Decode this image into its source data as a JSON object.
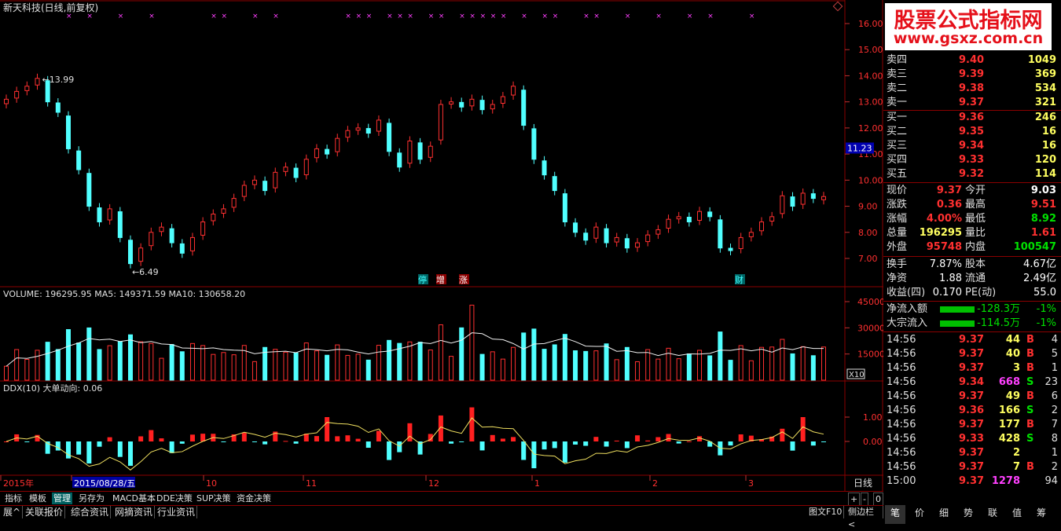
{
  "title": "新天科技(日线,前复权)",
  "price_axis": {
    "ticks": [
      "16.00",
      "15.00",
      "14.00",
      "13.00",
      "12.00",
      "11.00",
      "10.00",
      "9.00",
      "8.00",
      "7.00"
    ],
    "current_marker": "11.23"
  },
  "annotations": {
    "high": "13.99",
    "low": "6.49"
  },
  "x_marks": [
    "×",
    "×",
    "×",
    "×",
    "×",
    "×",
    "×",
    "×",
    "×",
    "×",
    "×",
    "×",
    "×",
    "×",
    "×",
    "×",
    "×",
    "×",
    "×",
    "×",
    "×",
    "×",
    "×",
    "×",
    "×",
    "×",
    "×",
    "×",
    "×",
    "×",
    "×"
  ],
  "event_tags": [
    {
      "text": "停",
      "color": "#40ffff"
    },
    {
      "text": "增",
      "color": "#ffffff"
    },
    {
      "text": "涨",
      "color": "#ffffff"
    },
    {
      "text": "财",
      "color": "#40ffff"
    }
  ],
  "volume": {
    "header": "VOLUME: 196295.95  MA5: 149371.59  MA10: 130658.20",
    "ticks": [
      "45000",
      "30000",
      "15000"
    ],
    "unit": "X10"
  },
  "ddx": {
    "header": "DDX(10)  大单动向: 0.06",
    "ticks": [
      "1.00",
      "0.00"
    ]
  },
  "date_axis": {
    "labels": [
      "2015年",
      "2015/08/28/五",
      "10",
      "11",
      "12",
      "1",
      "2",
      "3"
    ],
    "period": "日线"
  },
  "chart_data": [
    {
      "type": "candlestick",
      "title": "新天科技(日线,前复权)",
      "ylim": [
        6.4,
        16.3
      ],
      "y_ticks": [
        7,
        8,
        9,
        10,
        11,
        12,
        13,
        14,
        15,
        16
      ],
      "x_labels": [
        "2015年",
        "2015/08/28/五",
        "10",
        "11",
        "12",
        "1",
        "2",
        "3"
      ],
      "close_approx": [
        13.1,
        13.4,
        13.6,
        13.9,
        13.0,
        12.6,
        11.2,
        10.4,
        9.0,
        8.4,
        8.9,
        7.8,
        6.8,
        7.4,
        8.0,
        8.2,
        7.6,
        7.2,
        7.8,
        8.4,
        8.7,
        8.9,
        9.3,
        9.8,
        10.0,
        9.6,
        10.3,
        10.5,
        10.1,
        10.8,
        11.2,
        11.0,
        11.6,
        11.9,
        12.0,
        11.8,
        12.3,
        11.1,
        10.5,
        11.5,
        10.8,
        11.3,
        12.9,
        13.0,
        12.8,
        13.1,
        12.7,
        12.9,
        13.2,
        13.6,
        12.1,
        10.8,
        10.2,
        9.6,
        8.4,
        8.0,
        7.7,
        8.2,
        7.6,
        7.8,
        7.4,
        7.6,
        7.9,
        8.1,
        8.5,
        8.6,
        8.4,
        8.8,
        8.6,
        7.4,
        7.3,
        7.8,
        8.0,
        8.4,
        8.6,
        9.4,
        9.0,
        9.5,
        9.3,
        9.37
      ]
    },
    {
      "type": "bar",
      "title": "VOLUME",
      "series_names": [
        "VOLUME",
        "MA5",
        "MA10"
      ],
      "ylim": [
        0,
        50000
      ],
      "y_ticks": [
        15000,
        30000,
        45000
      ],
      "latest": {
        "VOLUME": 196295.95,
        "MA5": 149371.59,
        "MA10": 130658.2
      }
    },
    {
      "type": "bar",
      "title": "DDX(10)",
      "series_names": [
        "DDX",
        "大单动向"
      ],
      "ylim": [
        -1.0,
        1.5
      ],
      "y_ticks": [
        0.0,
        1.0
      ],
      "latest": {
        "大单动向": 0.06
      }
    }
  ],
  "toolbar": [
    "指标",
    "模板",
    "管理",
    "另存为",
    "MACD基本",
    "DDE决策",
    "SUP决策",
    "资金决策"
  ],
  "tabs": [
    "展^",
    "关联报价",
    "综合资讯",
    "网摘资讯",
    "行业资讯"
  ],
  "tool_right": [
    "图文F10",
    "侧边栏<"
  ],
  "zoom": [
    "+",
    "-",
    "0"
  ],
  "watermark": {
    "line1": "股票公式指标网",
    "line2": "www.gsxz.com.cn"
  },
  "order_book": [
    {
      "label": "卖四",
      "price": "9.40",
      "vol": "1049"
    },
    {
      "label": "卖三",
      "price": "9.39",
      "vol": "369"
    },
    {
      "label": "卖二",
      "price": "9.38",
      "vol": "534"
    },
    {
      "label": "卖一",
      "price": "9.37",
      "vol": "321"
    },
    {
      "label": "买一",
      "price": "9.36",
      "vol": "246"
    },
    {
      "label": "买二",
      "price": "9.35",
      "vol": "16"
    },
    {
      "label": "买三",
      "price": "9.34",
      "vol": "16"
    },
    {
      "label": "买四",
      "price": "9.33",
      "vol": "120"
    },
    {
      "label": "买五",
      "price": "9.32",
      "vol": "114"
    }
  ],
  "quote": [
    {
      "l1": "现价",
      "v1": "9.37",
      "c1": "#ff3030",
      "l2": "今开",
      "v2": "9.03",
      "c2": "#ffffff"
    },
    {
      "l1": "涨跌",
      "v1": "0.36",
      "c1": "#ff3030",
      "l2": "最高",
      "v2": "9.51",
      "c2": "#ff3030"
    },
    {
      "l1": "涨幅",
      "v1": "4.00%",
      "c1": "#ff3030",
      "l2": "最低",
      "v2": "8.92",
      "c2": "#00e000"
    },
    {
      "l1": "总量",
      "v1": "196295",
      "c1": "#ffff60",
      "l2": "量比",
      "v2": "1.61",
      "c2": "#ff3030"
    },
    {
      "l1": "外盘",
      "v1": "95748",
      "c1": "#ff3030",
      "l2": "内盘",
      "v2": "100547",
      "c2": "#00e000"
    }
  ],
  "fundamentals": [
    {
      "l1": "换手",
      "v1": "7.87%",
      "l2": "股本",
      "v2": "4.67亿"
    },
    {
      "l1": "净资",
      "v1": "1.88",
      "l2": "流通",
      "v2": "2.49亿"
    },
    {
      "l1": "收益(四)",
      "v1": "0.170",
      "l2": "PE(动)",
      "v2": "55.0"
    }
  ],
  "flows": [
    {
      "label": "净流入额",
      "value": "-128.3万",
      "pct": "-1%"
    },
    {
      "label": "大宗流入",
      "value": "-114.5万",
      "pct": "-1%"
    }
  ],
  "ticks": [
    {
      "t": "14:56",
      "p": "9.37",
      "pc": "#ff3030",
      "v": "44",
      "vc": "#ffff60",
      "bs": "B",
      "bc": "#ff3030",
      "n": "4"
    },
    {
      "t": "14:56",
      "p": "9.37",
      "pc": "#ff3030",
      "v": "40",
      "vc": "#ffff60",
      "bs": "B",
      "bc": "#ff3030",
      "n": "5"
    },
    {
      "t": "14:56",
      "p": "9.37",
      "pc": "#ff3030",
      "v": "3",
      "vc": "#ffff60",
      "bs": "B",
      "bc": "#ff3030",
      "n": "1"
    },
    {
      "t": "14:56",
      "p": "9.34",
      "pc": "#ff3030",
      "v": "668",
      "vc": "#ff40ff",
      "bs": "S",
      "bc": "#00e000",
      "n": "23"
    },
    {
      "t": "14:56",
      "p": "9.37",
      "pc": "#ff3030",
      "v": "49",
      "vc": "#ffff60",
      "bs": "B",
      "bc": "#ff3030",
      "n": "6"
    },
    {
      "t": "14:56",
      "p": "9.36",
      "pc": "#ff3030",
      "v": "166",
      "vc": "#ffff60",
      "bs": "S",
      "bc": "#00e000",
      "n": "2"
    },
    {
      "t": "14:56",
      "p": "9.37",
      "pc": "#ff3030",
      "v": "177",
      "vc": "#ffff60",
      "bs": "B",
      "bc": "#ff3030",
      "n": "7"
    },
    {
      "t": "14:56",
      "p": "9.33",
      "pc": "#ff3030",
      "v": "428",
      "vc": "#ffff60",
      "bs": "S",
      "bc": "#00e000",
      "n": "8"
    },
    {
      "t": "14:56",
      "p": "9.37",
      "pc": "#ff3030",
      "v": "2",
      "vc": "#ffff60",
      "bs": "",
      "bc": "#ff3030",
      "n": "1"
    },
    {
      "t": "14:56",
      "p": "9.37",
      "pc": "#ff3030",
      "v": "7",
      "vc": "#ffff60",
      "bs": "B",
      "bc": "#ff3030",
      "n": "2"
    },
    {
      "t": "15:00",
      "p": "9.37",
      "pc": "#ff3030",
      "v": "1278",
      "vc": "#ff40ff",
      "bs": "",
      "bc": "#ff3030",
      "n": "94"
    }
  ],
  "right_tabs": [
    "笔",
    "价",
    "细",
    "势",
    "联",
    "值",
    "筹"
  ]
}
